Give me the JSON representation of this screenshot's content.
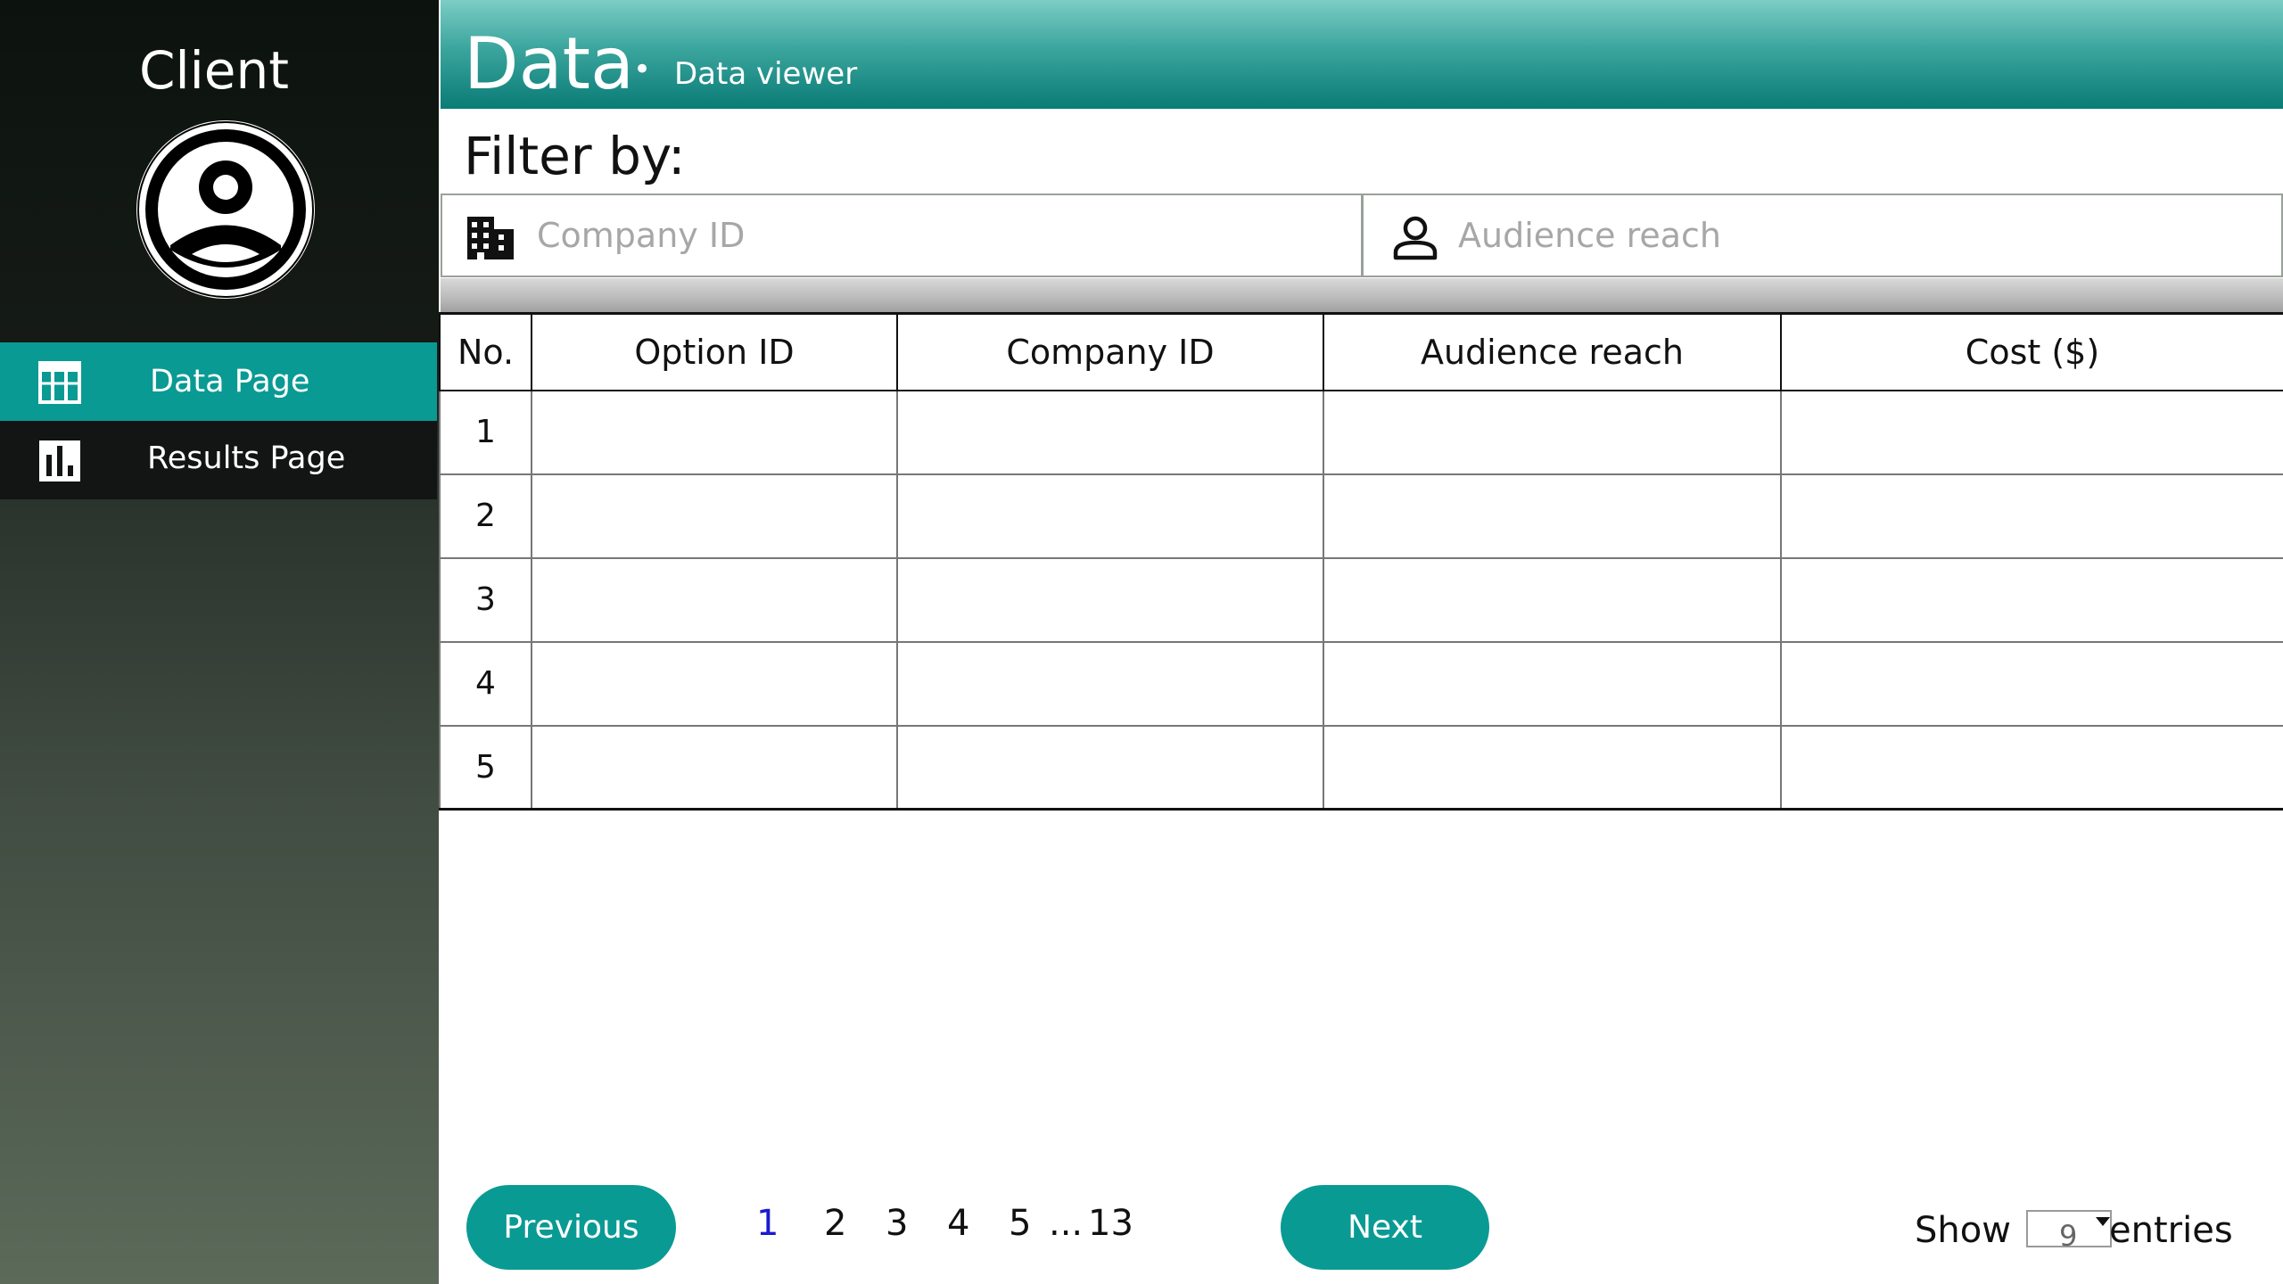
{
  "sidebar": {
    "title": "Client",
    "nav": [
      {
        "label": "Data Page",
        "icon": "table-icon",
        "active": true
      },
      {
        "label": "Results Page",
        "icon": "bar-chart-icon",
        "active": false
      }
    ]
  },
  "header": {
    "title": "Data",
    "separator": "•",
    "subtitle": "Data viewer"
  },
  "filters": {
    "label": "Filter by:",
    "company": {
      "placeholder": "Company ID",
      "value": "",
      "icon": "building-icon"
    },
    "audience": {
      "placeholder": "Audience reach",
      "value": "",
      "icon": "person-icon"
    }
  },
  "table": {
    "headers": [
      "No.",
      "Option ID",
      "Company ID",
      "Audience reach",
      "Cost ($)"
    ],
    "rows": [
      [
        "1",
        "",
        "",
        "",
        ""
      ],
      [
        "2",
        "",
        "",
        "",
        ""
      ],
      [
        "3",
        "",
        "",
        "",
        ""
      ],
      [
        "4",
        "",
        "",
        "",
        ""
      ],
      [
        "5",
        "",
        "",
        "",
        ""
      ]
    ]
  },
  "pagination": {
    "previous_label": "Previous",
    "next_label": "Next",
    "pages": [
      "1",
      "2",
      "3",
      "4",
      "5"
    ],
    "ellipsis": "...",
    "last_page": "13",
    "current_page": "1"
  },
  "entries": {
    "show_label": "Show",
    "selected": "9",
    "entries_label": "entries"
  },
  "colors": {
    "accent": "#0a9a94",
    "header_gradient_top": "#7ccdc5",
    "header_gradient_bottom": "#0a7b76",
    "sidebar_top": "#0c130e",
    "sidebar_bottom": "#5b6a59",
    "current_page": "#1a1ad0"
  }
}
